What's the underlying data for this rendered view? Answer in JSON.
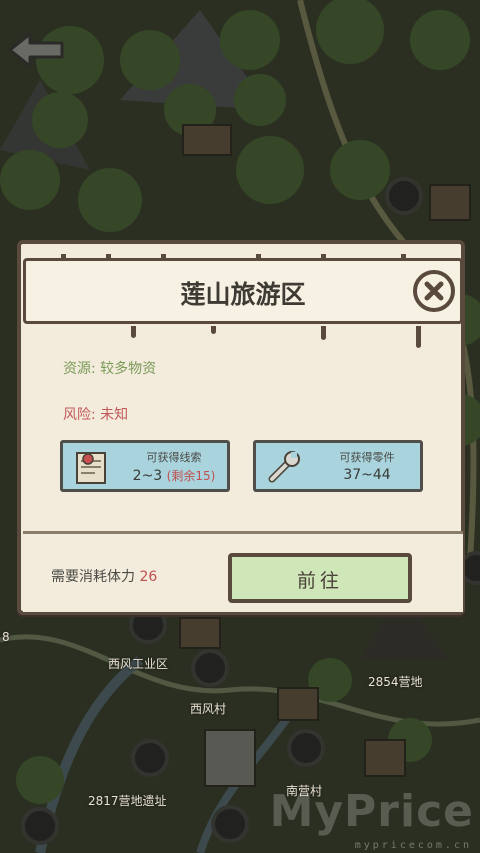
{
  "map": {
    "labels": [
      "西风工业区",
      "西风村",
      "2854营地",
      "2817营地遗址",
      "南营村",
      "8"
    ]
  },
  "dialog": {
    "title": "莲山旅游区",
    "resource_label": "资源: 较多物资",
    "risk_label": "风险: 未知",
    "clues": {
      "label": "可获得线索",
      "value": "2~3",
      "remaining": "(剩余15)",
      "icon": "map-scroll-icon"
    },
    "parts": {
      "label": "可获得零件",
      "value": "37~44",
      "icon": "wrench-icon"
    },
    "cost_label": "需要消耗体力",
    "cost_value": "26",
    "go_label": "前往"
  },
  "watermark": {
    "big": "MyPrice",
    "small": "mypricecom.cn"
  },
  "colors": {
    "dialog_bg": "#f3ecdc",
    "border": "#5a4a3e",
    "resource_text": "#7a9a58",
    "risk_text": "#c25a5a",
    "card_bg": "#a9d4de",
    "go_button_bg": "#cfe6b8"
  }
}
